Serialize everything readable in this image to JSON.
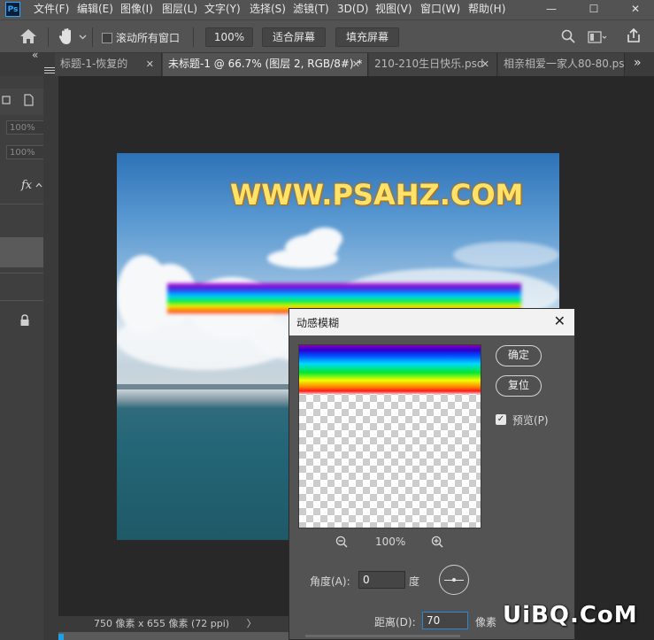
{
  "app": {
    "logo": "Ps",
    "menu": [
      "文件(F)",
      "编辑(E)",
      "图像(I)",
      "图层(L)",
      "文字(Y)",
      "选择(S)",
      "滤镜(T)",
      "3D(D)",
      "视图(V)",
      "窗口(W)",
      "帮助(H)"
    ],
    "window_controls": {
      "minimize": "—",
      "restore": "☐",
      "close": "✕"
    }
  },
  "options_bar": {
    "scroll_all_windows": "滚动所有窗口",
    "zoom_value": "100%",
    "fit_screen": "适合屏幕",
    "fill_screen": "填充屏幕"
  },
  "tabs": [
    {
      "label": "标题-1-恢复的",
      "active": false
    },
    {
      "label": "未标题-1 @ 66.7% (图层 2, RGB/8#) *",
      "active": true
    },
    {
      "label": "210-210生日快乐.psd",
      "active": false
    },
    {
      "label": "相亲相爱一家人80-80.psd",
      "active": false
    }
  ],
  "tab_overflow": "»",
  "tab_close": "✕",
  "left_panel": {
    "collapse_arrows": "«",
    "field1": "100%",
    "field2": "100%",
    "fx_label": "fx"
  },
  "canvas": {
    "watermark_text": "WWW.PSAHZ.COM"
  },
  "status_bar": {
    "doc_info": "750 像素 x 655 像素 (72 ppi)",
    "arrow": "〉"
  },
  "dialog": {
    "title": "动感模糊",
    "close": "✕",
    "ok": "确定",
    "reset": "复位",
    "preview_label": "预览(P)",
    "preview_checked": true,
    "zoom_value": "100%",
    "angle_label": "角度(A):",
    "angle_value": "0",
    "angle_unit": "度",
    "distance_label": "距离(D):",
    "distance_value": "70",
    "distance_unit": "像素"
  },
  "corner_watermark": "UiBQ.CoM",
  "colors": {
    "menu_bg": "#535353",
    "canvas_bg": "#282828",
    "dialog_bg": "#535353",
    "ps_blue": "#31a8ff"
  }
}
